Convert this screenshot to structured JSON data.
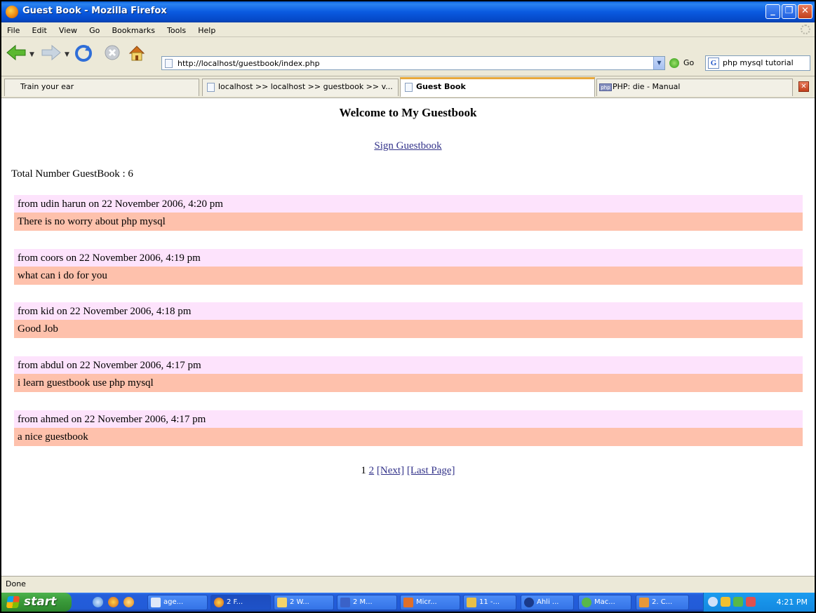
{
  "window": {
    "title": "Guest Book - Mozilla Firefox"
  },
  "menu": [
    "File",
    "Edit",
    "View",
    "Go",
    "Bookmarks",
    "Tools",
    "Help"
  ],
  "navbar": {
    "url": "http://localhost/guestbook/index.php",
    "go_label": "Go",
    "search_value": "php mysql tutorial"
  },
  "tabs": [
    {
      "label": "Train your ear",
      "active": false
    },
    {
      "label": "localhost >> localhost >> guestbook >> v...",
      "active": false
    },
    {
      "label": "Guest Book",
      "active": true
    },
    {
      "label": "PHP: die - Manual",
      "active": false
    }
  ],
  "page": {
    "heading": "Welcome to My Guestbook",
    "sign_link": "Sign Guestbook",
    "total": "Total Number GuestBook : 6",
    "entries": [
      {
        "header": "from udin harun on 22 November 2006, 4:20 pm",
        "message": "There is no worry about php mysql"
      },
      {
        "header": "from coors on 22 November 2006, 4:19 pm",
        "message": "what can i do for you"
      },
      {
        "header": "from kid on 22 November 2006, 4:18 pm",
        "message": "Good Job"
      },
      {
        "header": "from abdul on 22 November 2006, 4:17 pm",
        "message": "i learn guestbook use php mysql"
      },
      {
        "header": "from ahmed on 22 November 2006, 4:17 pm",
        "message": "a nice guestbook"
      }
    ],
    "pagination": {
      "current": "1",
      "page2": "2",
      "next": "[Next]",
      "last": "[Last Page]"
    }
  },
  "status": "Done",
  "taskbar": {
    "start_label": "start",
    "buttons": [
      "age...",
      "2 F...",
      "2 W...",
      "2 M...",
      "Micr...",
      "11 -...",
      "Ahli ...",
      "Mac...",
      "2. C..."
    ],
    "clock": "4:21 PM"
  },
  "colors": {
    "entry_header_bg": "#fde3fc",
    "entry_message_bg": "#fec1ac",
    "link": "#33338a",
    "xp_blue": "#0a5ae0"
  }
}
